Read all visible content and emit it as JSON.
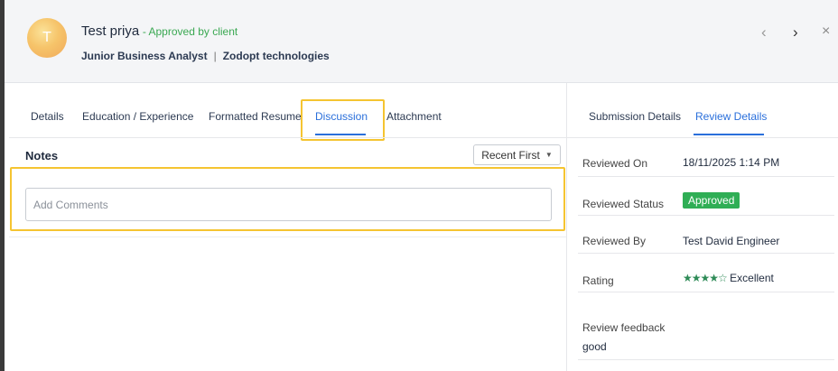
{
  "candidate": {
    "avatar_initial": "T",
    "name": "Test priya",
    "status": "- Approved by client",
    "role": "Junior Business Analyst",
    "separator": "|",
    "company": "Zodopt technologies"
  },
  "nav": {
    "prev": "‹",
    "next": "›",
    "close": "×"
  },
  "tabs": [
    {
      "label": "Details"
    },
    {
      "label": "Education / Experience"
    },
    {
      "label": "Formatted Resume"
    },
    {
      "label": "Discussion",
      "active": true
    },
    {
      "label": "Attachment"
    }
  ],
  "notes": {
    "title": "Notes",
    "sort_label": "Recent First",
    "sort_caret": "▼",
    "comment_placeholder": "Add Comments",
    "comment_value": ""
  },
  "right_tabs": [
    {
      "label": "Submission Details"
    },
    {
      "label": "Review Details",
      "active": true
    }
  ],
  "review": {
    "reviewed_on_label": "Reviewed On",
    "reviewed_on_value": "18/11/2025 1:14 PM",
    "status_label": "Reviewed Status",
    "status_value": "Approved",
    "reviewed_by_label": "Reviewed By",
    "reviewed_by_value": "Test David Engineer",
    "rating_label": "Rating",
    "rating_stars": "★★★★☆",
    "rating_value": 4,
    "rating_max": 5,
    "rating_text": "Excellent",
    "feedback_label": "Review feedback",
    "feedback_value": "good"
  },
  "colors": {
    "accent": "#2a6fdb",
    "approved_green": "#2fae55",
    "highlight": "#f5c431",
    "header_bg": "#f4f5f7"
  }
}
